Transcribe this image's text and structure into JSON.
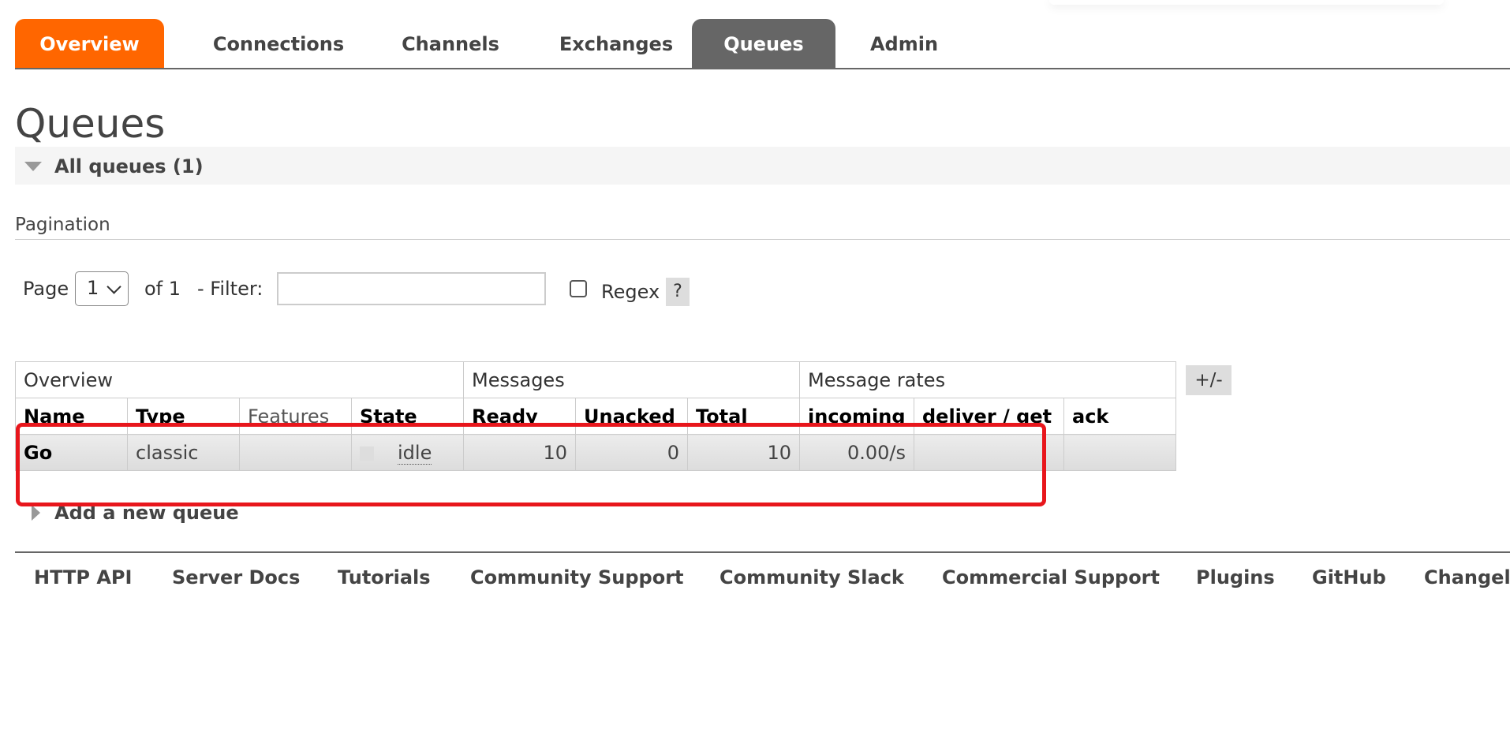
{
  "nav": {
    "tabs": [
      "Overview",
      "Connections",
      "Channels",
      "Exchanges",
      "Queues",
      "Admin"
    ],
    "active_tab": "Queues"
  },
  "page": {
    "title": "Queues",
    "section_title": "All queues (1)"
  },
  "pagination": {
    "label": "Pagination",
    "page_label": "Page",
    "page_value": "1",
    "of_label": "of 1",
    "filter_label": "- Filter:",
    "filter_value": "",
    "regex_label": "Regex",
    "help_label": "?"
  },
  "table": {
    "groups": [
      "Overview",
      "Messages",
      "Message rates"
    ],
    "columns": [
      "Name",
      "Type",
      "Features",
      "State",
      "Ready",
      "Unacked",
      "Total",
      "incoming",
      "deliver / get",
      "ack"
    ],
    "rows": [
      {
        "name": "Go",
        "type": "classic",
        "features": "",
        "state": "idle",
        "ready": "10",
        "unacked": "0",
        "total": "10",
        "incoming": "0.00/s",
        "deliver_get": "",
        "ack": ""
      }
    ],
    "toggle_columns": "+/-"
  },
  "add_queue": {
    "label": "Add a new queue"
  },
  "footer": {
    "links": [
      "HTTP API",
      "Server Docs",
      "Tutorials",
      "Community Support",
      "Community Slack",
      "Commercial Support",
      "Plugins",
      "GitHub",
      "Changelog"
    ]
  },
  "annotation": {
    "color": "#e8161c"
  },
  "colors": {
    "brand_orange": "#ff6600",
    "active_tab": "#666666"
  }
}
